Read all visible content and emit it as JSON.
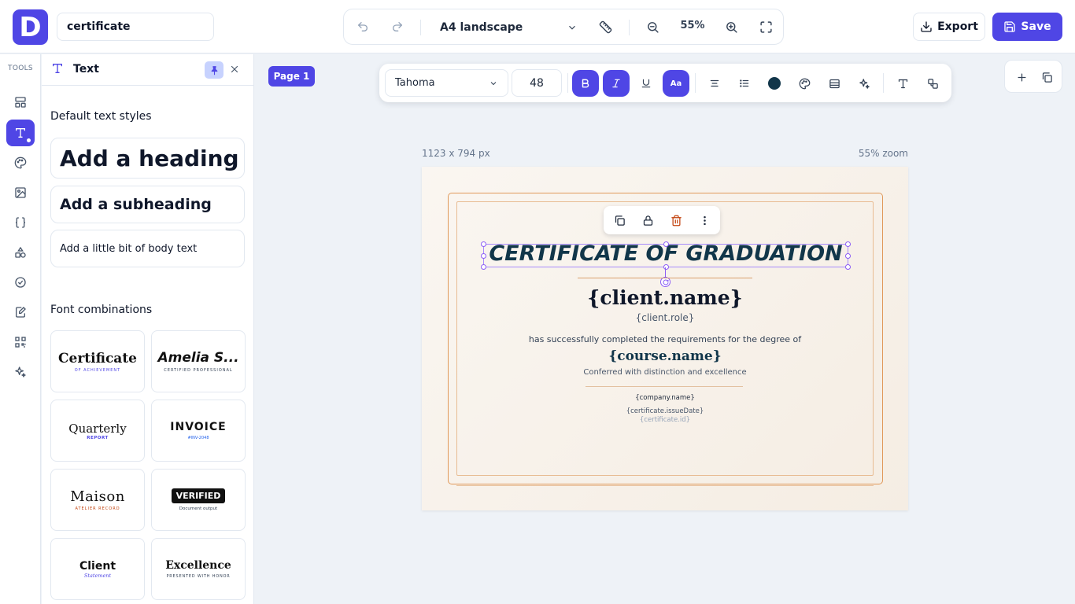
{
  "app": {
    "logo_letter": "D",
    "document_name": "certificate"
  },
  "toolbar": {
    "page_size": "A4 landscape",
    "zoom": "55%"
  },
  "actions": {
    "export": "Export",
    "save": "Save"
  },
  "rail": {
    "title": "TOOLS"
  },
  "panel": {
    "title": "Text",
    "default_styles_title": "Default text styles",
    "heading": "Add a heading",
    "subheading": "Add a subheading",
    "body": "Add a little bit of body text",
    "combos_title": "Font combinations",
    "combos": [
      {
        "main": "Certificate",
        "sub": "OF ACHIEVEMENT"
      },
      {
        "main": "Amelia S...",
        "sub": "CERTIFIED PROFESSIONAL"
      },
      {
        "main": "Quarterly",
        "sub": "REPORT"
      },
      {
        "main": "INVOICE",
        "sub": "#INV-2048"
      },
      {
        "main": "Maison",
        "sub": "ATELIER RECORD"
      },
      {
        "main": "VERIFIED",
        "sub": "Document output"
      },
      {
        "main": "Client",
        "sub": "Statement"
      },
      {
        "main": "Excellence",
        "sub": "PRESENTED WITH HONOR"
      }
    ]
  },
  "canvas": {
    "page_label": "Page 1",
    "dimensions": "1123 x 794 px",
    "zoom_label": "55% zoom"
  },
  "format": {
    "font": "Tahoma",
    "size": "48",
    "case_label": "Aa",
    "color": "#11364a"
  },
  "certificate": {
    "title": "CERTIFICATE OF GRADUATION",
    "client_name": "{client.name}",
    "client_role": "{client.role}",
    "description": "has successfully completed the requirements for the degree of",
    "course_name": "{course.name}",
    "conferred": "Conferred with distinction and excellence",
    "company": "{company.name}",
    "issue_date": "{certificate.issueDate}",
    "cert_id": "{certificate.id}"
  },
  "colors": {
    "accent": "#4f46e5",
    "title_text": "#11364a",
    "border": "#e0995a"
  }
}
